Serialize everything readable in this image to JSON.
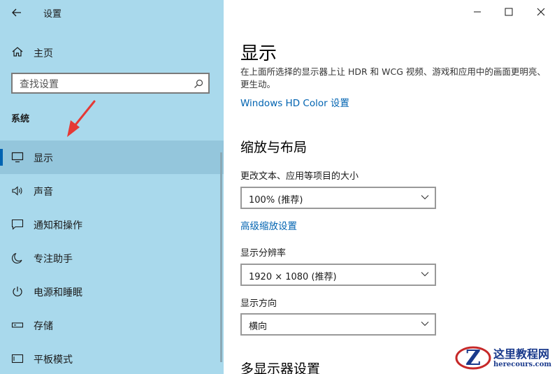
{
  "window": {
    "title": "设置",
    "controls": [
      "minimize",
      "maximize",
      "close"
    ]
  },
  "sidebar": {
    "home_label": "主页",
    "search": {
      "placeholder": "查找设置",
      "value": ""
    },
    "section_header": "系统",
    "items": [
      {
        "label": "显示",
        "icon": "monitor-icon",
        "active": true
      },
      {
        "label": "声音",
        "icon": "speaker-icon",
        "active": false
      },
      {
        "label": "通知和操作",
        "icon": "notification-icon",
        "active": false
      },
      {
        "label": "专注助手",
        "icon": "moon-icon",
        "active": false
      },
      {
        "label": "电源和睡眠",
        "icon": "power-icon",
        "active": false
      },
      {
        "label": "存储",
        "icon": "storage-icon",
        "active": false
      },
      {
        "label": "平板模式",
        "icon": "tablet-icon",
        "active": false
      }
    ]
  },
  "main": {
    "title": "显示",
    "description": "在上面所选择的显示器上让 HDR 和 WCG 视频、游戏和应用中的画面更明亮、更生动。",
    "hdr_link": "Windows HD Color 设置",
    "scale_section": "缩放与布局",
    "scale_label": "更改文本、应用等项目的大小",
    "scale_value": "100% (推荐)",
    "advanced_scale_link": "高级缩放设置",
    "resolution_label": "显示分辨率",
    "resolution_value": "1920 × 1080 (推荐)",
    "orientation_label": "显示方向",
    "orientation_value": "横向",
    "multi_display_section": "多显示器设置"
  },
  "watermark": {
    "title": "这里教程网",
    "url": "herecours.com"
  },
  "colors": {
    "sidebar_bg": "#a9d9ec",
    "active_item_bg": "#94c6dc",
    "accent": "#0063b1",
    "annotation_arrow": "#e53935"
  }
}
